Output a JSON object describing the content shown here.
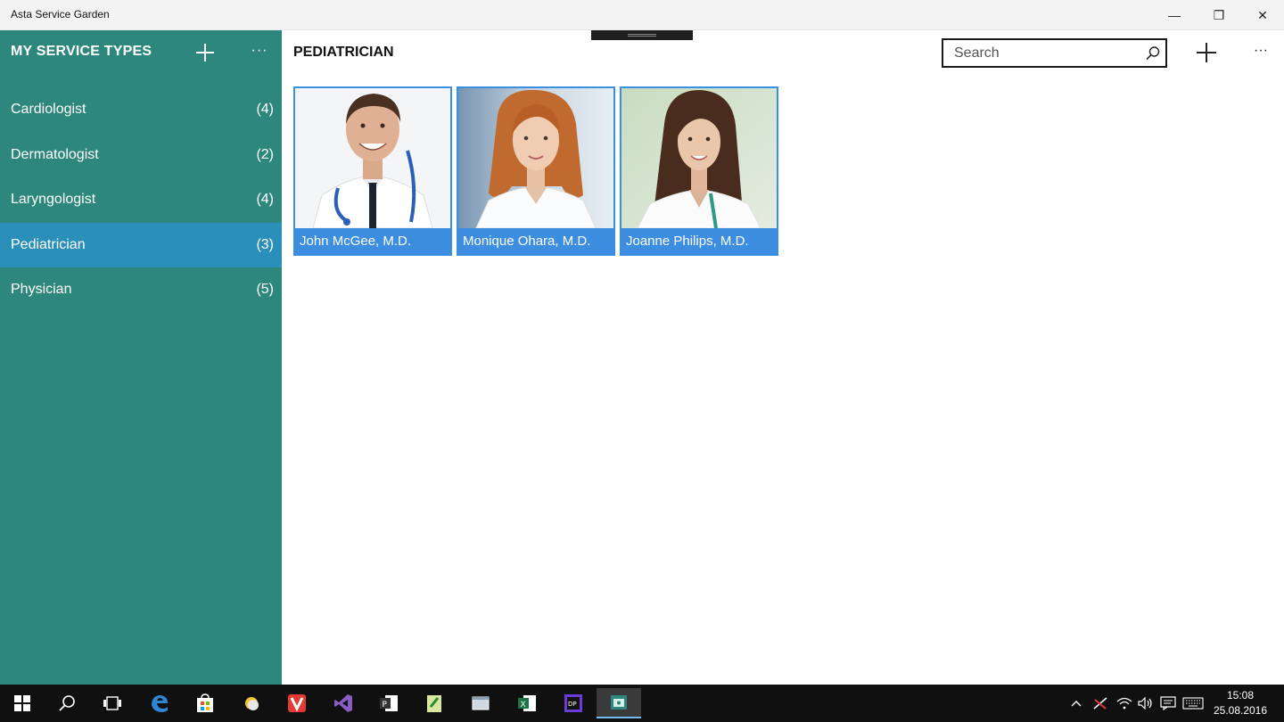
{
  "window": {
    "title": "Asta Service Garden",
    "minimize_glyph": "—",
    "maximize_glyph": "❐",
    "close_glyph": "✕"
  },
  "sidebar": {
    "title": "MY SERVICE TYPES",
    "more_glyph": "···",
    "items": [
      {
        "label": "Cardiologist",
        "count": "(4)"
      },
      {
        "label": "Dermatologist",
        "count": "(2)"
      },
      {
        "label": "Laryngologist",
        "count": "(4)"
      },
      {
        "label": "Pediatrician",
        "count": "(3)",
        "selected": true
      },
      {
        "label": "Physician",
        "count": "(5)"
      }
    ]
  },
  "main": {
    "title": "PEDIATRICIAN",
    "search": {
      "placeholder": "Search",
      "value": ""
    },
    "more_glyph": "···",
    "doctors": [
      {
        "name": "John McGee, M.D."
      },
      {
        "name": "Monique Ohara, M.D."
      },
      {
        "name": "Joanne Philips, M.D."
      }
    ]
  },
  "taskbar": {
    "time": "15:08",
    "date": "25.08.2016",
    "apps": [
      "windows-start",
      "search",
      "task-view",
      "edge",
      "store",
      "app-sun",
      "vivaldi",
      "visual-studio",
      "project",
      "notepad-plus",
      "app-window",
      "excel",
      "dotpeek",
      "asta-service-garden"
    ]
  },
  "colors": {
    "sidebar": "#2e877c",
    "selected": "#2a8fb9",
    "card_caption": "#3d8ee0",
    "taskbar": "#101010"
  }
}
